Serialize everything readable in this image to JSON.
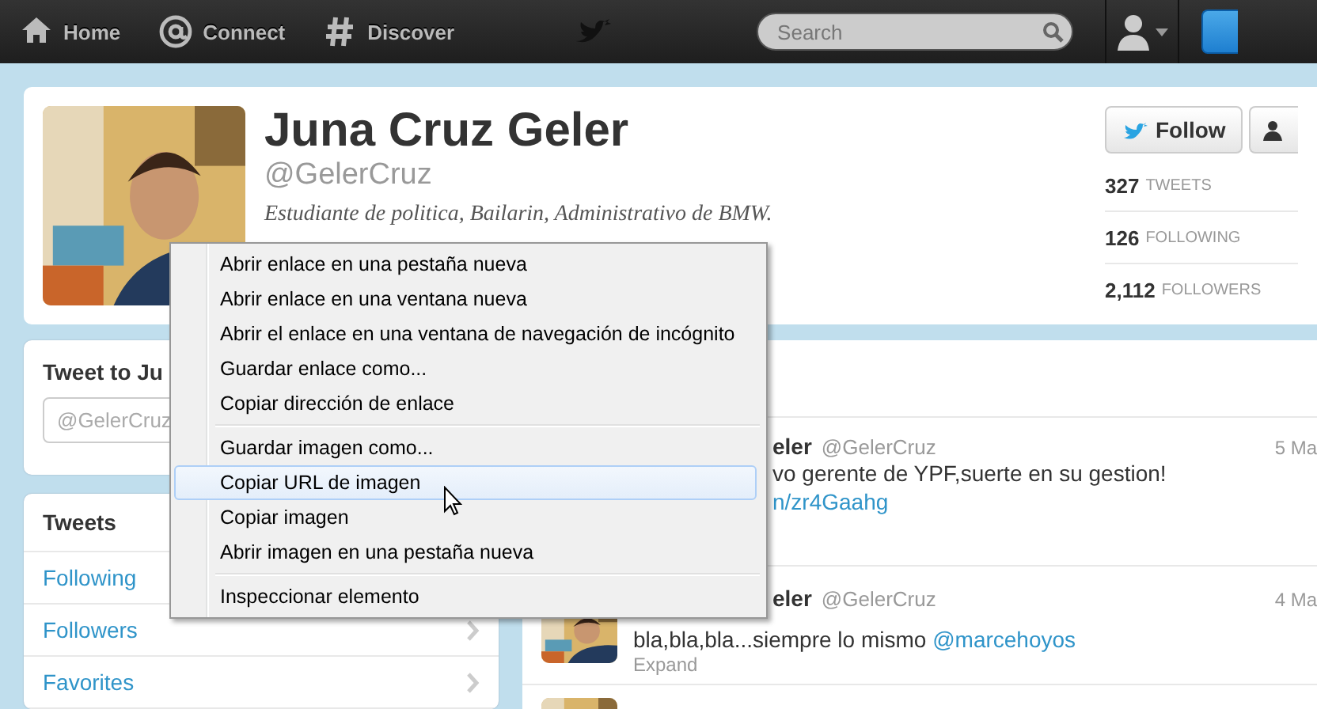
{
  "topbar": {
    "nav": [
      {
        "label": "Home",
        "kind": "home"
      },
      {
        "label": "Connect",
        "kind": "at"
      },
      {
        "label": "Discover",
        "kind": "hash"
      }
    ],
    "search": {
      "placeholder": "Search"
    }
  },
  "profile": {
    "name": "Juna Cruz Geler",
    "handle": "@GelerCruz",
    "bio": "Estudiante de politica, Bailarin, Administrativo de BMW.",
    "follow_button": "Follow",
    "stats": [
      {
        "count": "327",
        "label": "TWEETS"
      },
      {
        "count": "126",
        "label": "FOLLOWING"
      },
      {
        "count": "2,112",
        "label": "FOLLOWERS"
      }
    ]
  },
  "tweet_to": {
    "title": "Tweet to Ju",
    "field_value": "@GelerCruz"
  },
  "sidebar": {
    "items": [
      {
        "label": "Tweets",
        "selected": true
      },
      {
        "label": "Following",
        "selected": false
      },
      {
        "label": "Followers",
        "selected": false
      },
      {
        "label": "Favorites",
        "selected": false
      }
    ]
  },
  "timeline": {
    "tweets": [
      {
        "name": "eler",
        "handle": "@GelerCruz",
        "date": "5 Ma",
        "lines": [
          {
            "text": "vo gerente de YPF,suerte en su gestion!",
            "kind": "text"
          },
          {
            "text": "n/zr4Gaahg",
            "kind": "link"
          }
        ]
      },
      {
        "name": "eler",
        "handle": "@GelerCruz",
        "date": "4 Ma",
        "lines": [
          {
            "text": "bla,bla,bla...siempre lo mismo ",
            "kind": "text",
            "mention": "@marcehoyos"
          },
          {
            "text": "Expand",
            "kind": "expand"
          }
        ]
      }
    ]
  },
  "context_menu": {
    "groups": [
      [
        {
          "label": "Abrir enlace en una pestaña nueva",
          "selected": false
        },
        {
          "label": "Abrir enlace en una ventana nueva",
          "selected": false
        },
        {
          "label": "Abrir el enlace en una ventana de navegación de incógnito",
          "selected": false
        },
        {
          "label": "Guardar enlace como...",
          "selected": false
        },
        {
          "label": "Copiar dirección de enlace",
          "selected": false
        }
      ],
      [
        {
          "label": "Guardar imagen como...",
          "selected": false
        },
        {
          "label": "Copiar URL de imagen",
          "selected": true
        },
        {
          "label": "Copiar imagen",
          "selected": false
        },
        {
          "label": "Abrir imagen en una pestaña nueva",
          "selected": false
        }
      ],
      [
        {
          "label": "Inspeccionar elemento",
          "selected": false
        }
      ]
    ]
  }
}
